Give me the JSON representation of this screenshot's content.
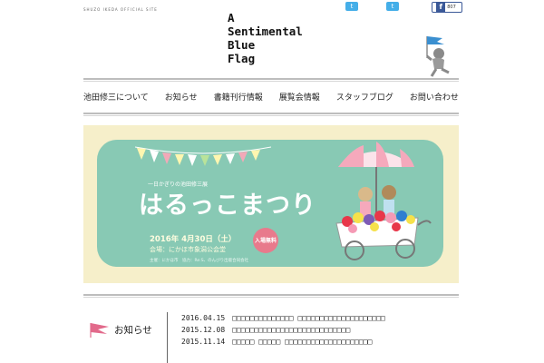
{
  "site": {
    "tagline": "SHUZO IKEDA OFFICIAL SITE",
    "title_lines": [
      "A",
      "Sentimental",
      "Blue",
      "Flag"
    ]
  },
  "social": {
    "twitter_glyph": "t",
    "facebook_glyph": "f",
    "facebook_count": "807"
  },
  "nav": {
    "items": [
      "池田修三について",
      "お知らせ",
      "書籍刊行情報",
      "展覧会情報",
      "スタッフブログ",
      "お問い合わせ"
    ]
  },
  "banner": {
    "subtitle": "一日かぎりの池田修三展",
    "title": "はるっこまつり",
    "date": "2016年 4月30日（土）",
    "venue": "会場：にかほ市象潟公会堂",
    "organizer": "主催：にかほ市　協力：Re:S、のんびり出版合同会社",
    "badge": "入場無料",
    "colors": {
      "card": "#88c9b4",
      "background": "#f6efca",
      "badge": "#e87a8c"
    }
  },
  "news": {
    "heading": "お知らせ",
    "items": [
      {
        "date": "2016.04.15",
        "title": "□□□□□□□□□□□□□□ □□□□□□□□□□□□□□□□□□□□"
      },
      {
        "date": "2015.12.08",
        "title": "□□□□□□□□□□□□□□□□□□□□□□□□□□□"
      },
      {
        "date": "2015.11.14",
        "title": "□□□□□ □□□□□ □□□□□□□□□□□□□□□□□□□□"
      }
    ]
  }
}
